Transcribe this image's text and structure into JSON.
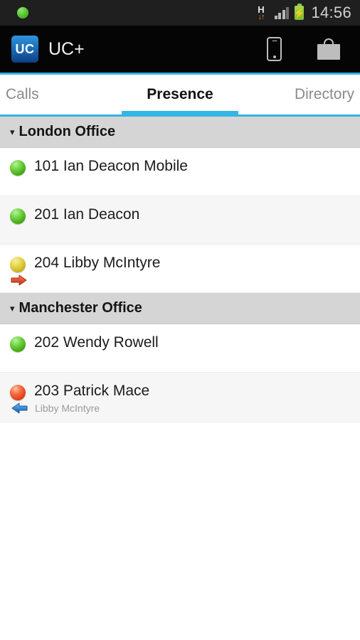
{
  "status_bar": {
    "notification_icon": "green-dot-icon",
    "data_network": {
      "letter": "H",
      "arrows": "↓↑",
      "icon": "hspa-data-icon"
    },
    "signal_icon": "signal-bars-icon",
    "battery": {
      "icon": "battery-charging-icon",
      "bolt": "⚡"
    },
    "clock": "14:56"
  },
  "action_bar": {
    "app_icon_label": "UC",
    "app_title": "UC+",
    "icons": [
      {
        "name": "mobile-phone-icon",
        "label": "Mobile"
      },
      {
        "name": "briefcase-icon",
        "label": "Work"
      }
    ]
  },
  "tabs": [
    {
      "label": "Calls",
      "active": false
    },
    {
      "label": "Presence",
      "active": true
    },
    {
      "label": "Directory",
      "active": false
    }
  ],
  "accent_color": "#33b5e5",
  "presence_colors": {
    "available": "#5bc32b",
    "away": "#d9c62a",
    "busy": "#ef4f22"
  },
  "groups": [
    {
      "title": "London Office",
      "caret": "▾",
      "contacts": [
        {
          "extension": "101",
          "name": "Ian Deacon Mobile",
          "display": "101 Ian Deacon Mobile",
          "status": "available",
          "sub_icon": null,
          "sub_text": null
        },
        {
          "extension": "201",
          "name": "Ian Deacon",
          "display": "201 Ian Deacon",
          "status": "available",
          "sub_icon": null,
          "sub_text": null
        },
        {
          "extension": "204",
          "name": "Libby McIntyre",
          "display": "204 Libby McIntyre",
          "status": "away",
          "sub_icon": "outgoing-call-arrow-icon",
          "sub_text": ""
        }
      ]
    },
    {
      "title": "Manchester Office",
      "caret": "▾",
      "contacts": [
        {
          "extension": "202",
          "name": "Wendy Rowell",
          "display": "202 Wendy Rowell",
          "status": "available",
          "sub_icon": null,
          "sub_text": null
        },
        {
          "extension": "203",
          "name": "Patrick Mace",
          "display": "203 Patrick Mace",
          "status": "busy",
          "sub_icon": "incoming-call-arrow-icon",
          "sub_text": "Libby McIntyre"
        }
      ]
    }
  ]
}
